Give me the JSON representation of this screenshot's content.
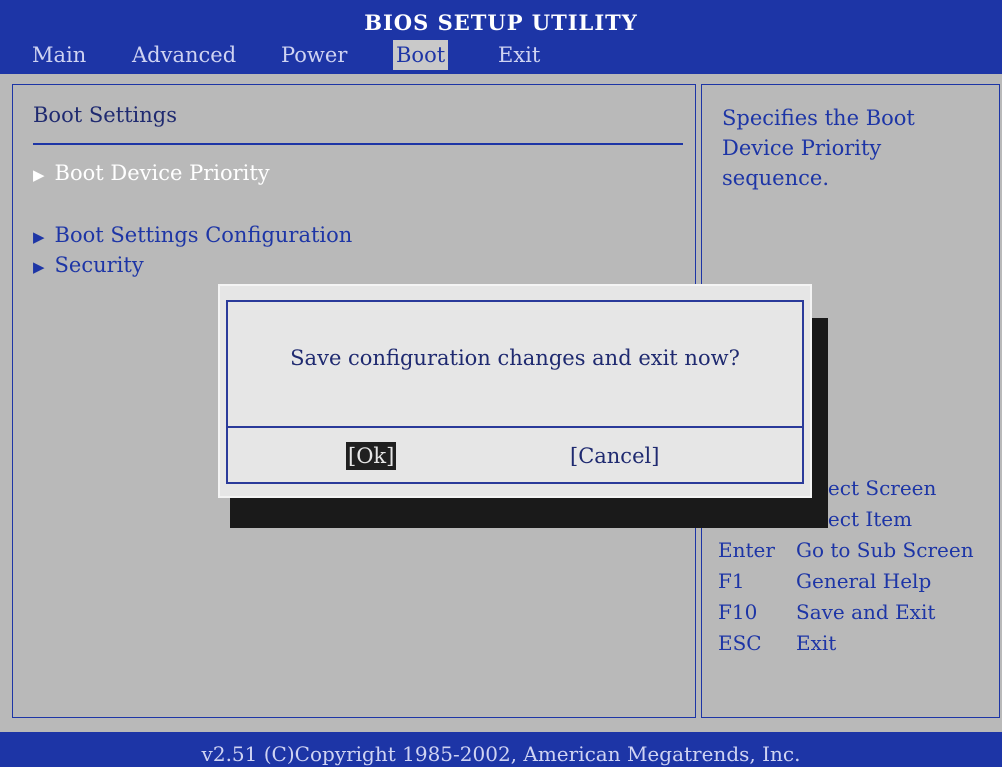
{
  "header": {
    "title": "BIOS SETUP UTILITY"
  },
  "menu": {
    "tabs": [
      {
        "label": "Main"
      },
      {
        "label": "Advanced"
      },
      {
        "label": "Power"
      },
      {
        "label": "Boot"
      },
      {
        "label": "Exit"
      }
    ],
    "active_tab": "Boot"
  },
  "panel": {
    "section_title": "Boot Settings",
    "items": [
      {
        "label": "Boot Device Priority"
      },
      {
        "label": "Boot Settings Configuration"
      },
      {
        "label": "Security"
      }
    ],
    "arrow": "▶"
  },
  "help": {
    "text": "Specifies the Boot Device Priority sequence.",
    "keys": [
      {
        "key": "",
        "desc": "Select Screen"
      },
      {
        "key": "↑↓",
        "desc": "Select Item"
      },
      {
        "key": "Enter",
        "desc": "Go to Sub Screen"
      },
      {
        "key": "F1",
        "desc": "General Help"
      },
      {
        "key": "F10",
        "desc": "Save and Exit"
      },
      {
        "key": "ESC",
        "desc": "Exit"
      }
    ]
  },
  "dialog": {
    "question": "Save configuration changes and exit now?",
    "ok_label": "[Ok]",
    "cancel_label": "[Cancel]"
  },
  "footer": {
    "copyright": "v2.51 (C)Copyright 1985-2002, American Megatrends, Inc."
  },
  "colors": {
    "accent": "#1d35a6",
    "background": "#b9b9b9",
    "dialog": "#e6e6e6"
  }
}
